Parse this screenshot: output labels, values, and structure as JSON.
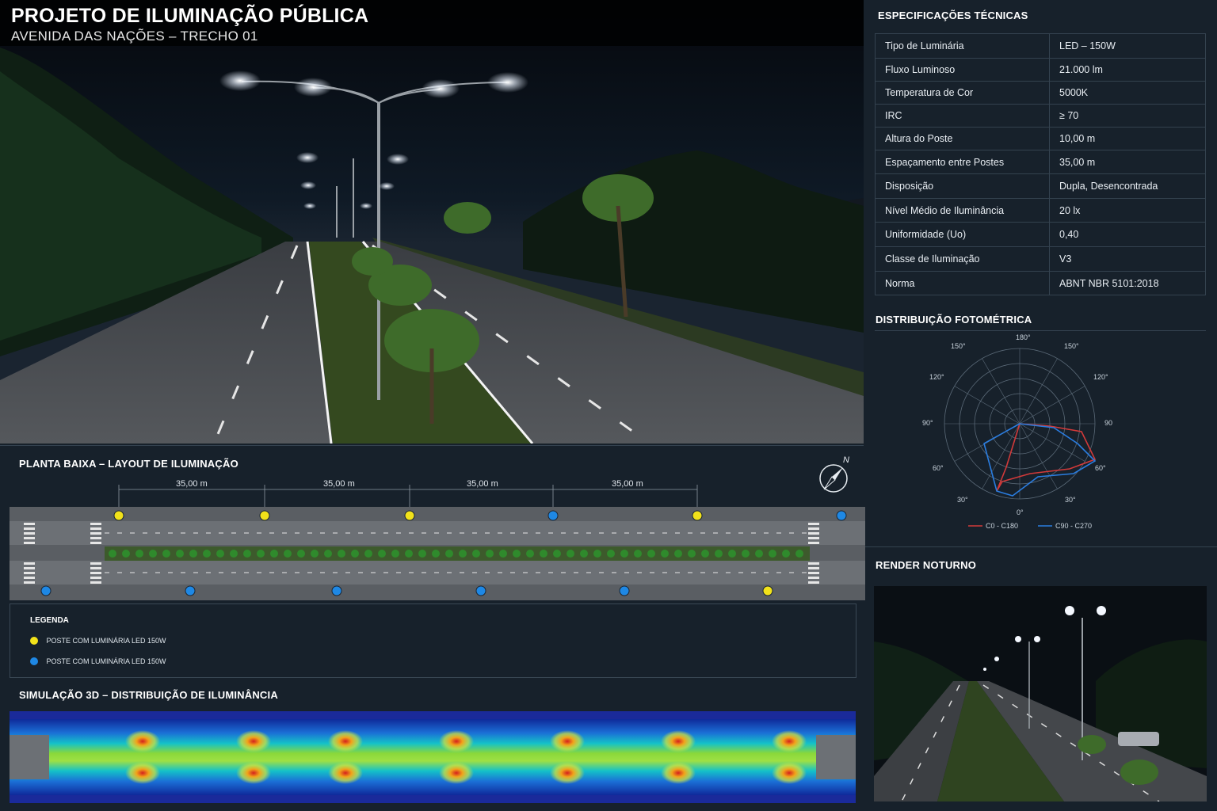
{
  "header": {
    "title": "PROJETO DE ILUMINAÇÃO PÚBLICA",
    "subtitle": "AVENIDA DAS NAÇÕES – TRECHO 01"
  },
  "specs": {
    "title": "ESPECIFICAÇÕES TÉCNICAS",
    "rows": [
      {
        "label": "Tipo de Luminária",
        "value": "LED – 150W"
      },
      {
        "label": "Fluxo Luminoso",
        "value": "21.000 lm"
      },
      {
        "label": "Temperatura de Cor",
        "value": "5000K"
      },
      {
        "label": "IRC",
        "value": "≥ 70"
      },
      {
        "label": "Altura do Poste",
        "value": "10,00 m"
      },
      {
        "label": "Espaçamento entre Postes",
        "value": "35,00 m"
      },
      {
        "label": "Disposição",
        "value": "Dupla, Desencontrada"
      },
      {
        "label": "Nível Médio de Iluminância",
        "value": "20 lx"
      },
      {
        "label": "Uniformidade (Uo)",
        "value": "0,40"
      },
      {
        "label": "Classe de Iluminação",
        "value": "V3"
      },
      {
        "label": "Norma",
        "value": "ABNT NBR 5101:2018"
      }
    ]
  },
  "photometric": {
    "title": "DISTRIBUIÇÃO FOTOMÉTRICA",
    "angle_labels": {
      "top": "180°",
      "upper_left": "150°",
      "upper_right": "150°",
      "mid_upper_left": "120°",
      "mid_upper_right": "120°",
      "left": "90°",
      "right": "90",
      "lower_left": "60°",
      "lower_right": "60°",
      "bottom_left": "30°",
      "bottom_right": "30°",
      "bottom": "0°"
    },
    "legend": [
      {
        "name": "C0 - C180",
        "color": "#d23a3a"
      },
      {
        "name": "C90 - C270",
        "color": "#2a7de0"
      }
    ]
  },
  "plan": {
    "title": "PLANTA BAIXA – LAYOUT DE ILUMINAÇÃO",
    "spacing_labels": [
      "35,00 m",
      "35,00 m",
      "35,00 m",
      "35,00 m"
    ],
    "compass_label": "N",
    "legend_title": "LEGENDA",
    "legend": [
      {
        "label": "POSTE COM LUMINÁRIA LED 150W",
        "color": "#f2e21a"
      },
      {
        "label": "POSTE COM LUMINÁRIA LED 150W",
        "color": "#1e88e5"
      }
    ]
  },
  "simulation": {
    "title": "SIMULAÇÃO 3D – DISTRIBUIÇÃO DE ILUMINÂNCIA"
  },
  "render": {
    "title": "RENDER NOTURNO"
  },
  "colors": {
    "background": "#17212b",
    "pole_yellow": "#f2e21a",
    "pole_blue": "#1e88e5",
    "curve_red": "#d23a3a",
    "curve_blue": "#2a7de0"
  }
}
